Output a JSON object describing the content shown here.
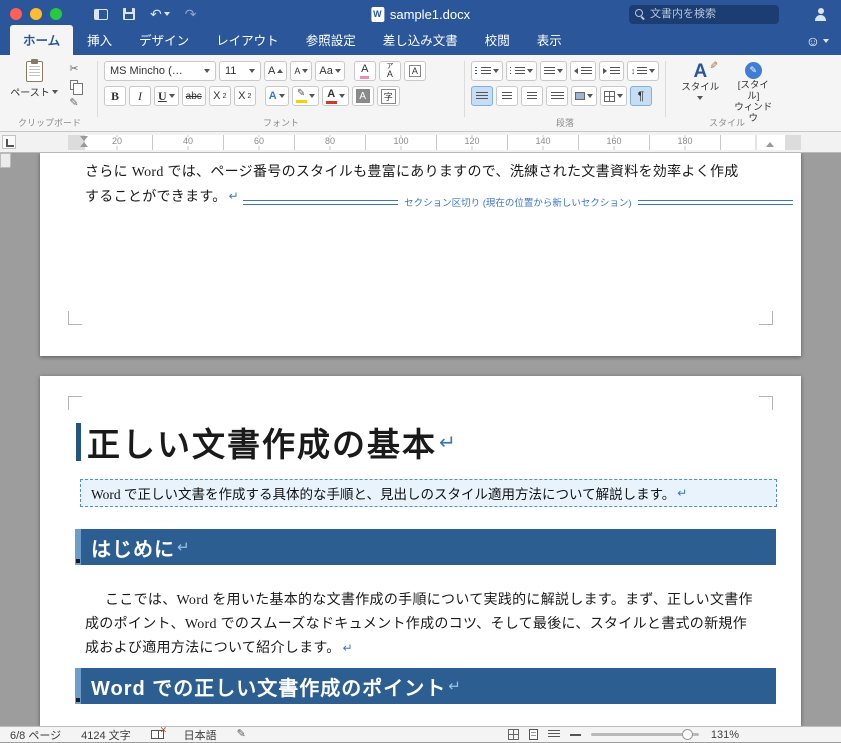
{
  "titlebar": {
    "title": "sample1.docx",
    "doc_icon_letter": "W",
    "search_placeholder": "文書内を検索"
  },
  "tabs": [
    {
      "label": "ホーム",
      "active": true
    },
    {
      "label": "挿入"
    },
    {
      "label": "デザイン"
    },
    {
      "label": "レイアウト"
    },
    {
      "label": "参照設定"
    },
    {
      "label": "差し込み文書"
    },
    {
      "label": "校閲"
    },
    {
      "label": "表示"
    }
  ],
  "ribbon": {
    "clipboard": {
      "label": "クリップボード",
      "paste": "ペースト"
    },
    "font": {
      "label": "フォント",
      "name": "MS Mincho (…",
      "size": "11",
      "grow": "A",
      "shrink": "A",
      "case": "Aa",
      "clear": "A",
      "ruby_top": "ア",
      "ruby_bottom": "A",
      "char_border": "A",
      "bold": "B",
      "italic": "I",
      "underline": "U",
      "strike": "abc",
      "sub_x": "X",
      "sub_n": "2",
      "sup_x": "X",
      "sup_n": "2",
      "effects": "A",
      "color": "A",
      "shade": "A",
      "enclose": "字"
    },
    "paragraph": {
      "label": "段落"
    },
    "styles": {
      "label": "スタイル",
      "styles_a": "A",
      "styles_btn": "スタイル",
      "pane_line1": "[スタイル]",
      "pane_line2": "ウィンドウ"
    }
  },
  "icons": {
    "scissors": "✂",
    "format_painter": "✎",
    "brush": "✎",
    "pen": "✎",
    "undo": "↶",
    "redo": "↷",
    "smiley": "☺",
    "pilcrow": "¶",
    "updown": "↕",
    "return": "↵",
    "search": "css-magnifier",
    "save": "css-floppy",
    "sidebar": "css-rect",
    "copy": "css-pages",
    "clipboard": "css-clipboard",
    "share_person": "css-person",
    "spellcheck_book": "css-book"
  },
  "ruler": {
    "ticks": [
      "20",
      "40",
      "60",
      "80",
      "100",
      "120",
      "140",
      "160",
      "180"
    ]
  },
  "doc": {
    "page1": {
      "line1": "さらに Word では、ページ番号のスタイルも豊富にありますので、洗練された文書資料を効率よく作成",
      "line2": "することができます。",
      "section_break": "セクション区切り (現在の位置から新しいセクション)"
    },
    "page2": {
      "h1": "正しい文書作成の基本",
      "callout": "Word で正しい文書を作成する具体的な手順と、見出しのスタイル適用方法について解説します。",
      "h2_intro": "はじめに",
      "para1": "ここでは、Word を用いた基本的な文書作成の手順について実践的に解説します。まず、正しい文書作",
      "para2": "成のポイント、Word でのスムーズなドキュメント作成のコツ、そして最後に、スタイルと書式の新規作",
      "para3": "成および適用方法について紹介します。",
      "h2_points": "Word での正しい文書作成のポイント"
    }
  },
  "statusbar": {
    "page": "6/8 ページ",
    "chars": "4124 文字",
    "language": "日本語",
    "zoom": "131%"
  },
  "colors": {
    "titlebar": "#2b579a",
    "heading_banner": "#2d5e92",
    "heading_stripe": "#6f9dc9",
    "section_break": "#3a76c4",
    "callout_bg": "#e9f3fc",
    "callout_border": "#4f90d1",
    "pressed_button": "#c6ddf4"
  }
}
